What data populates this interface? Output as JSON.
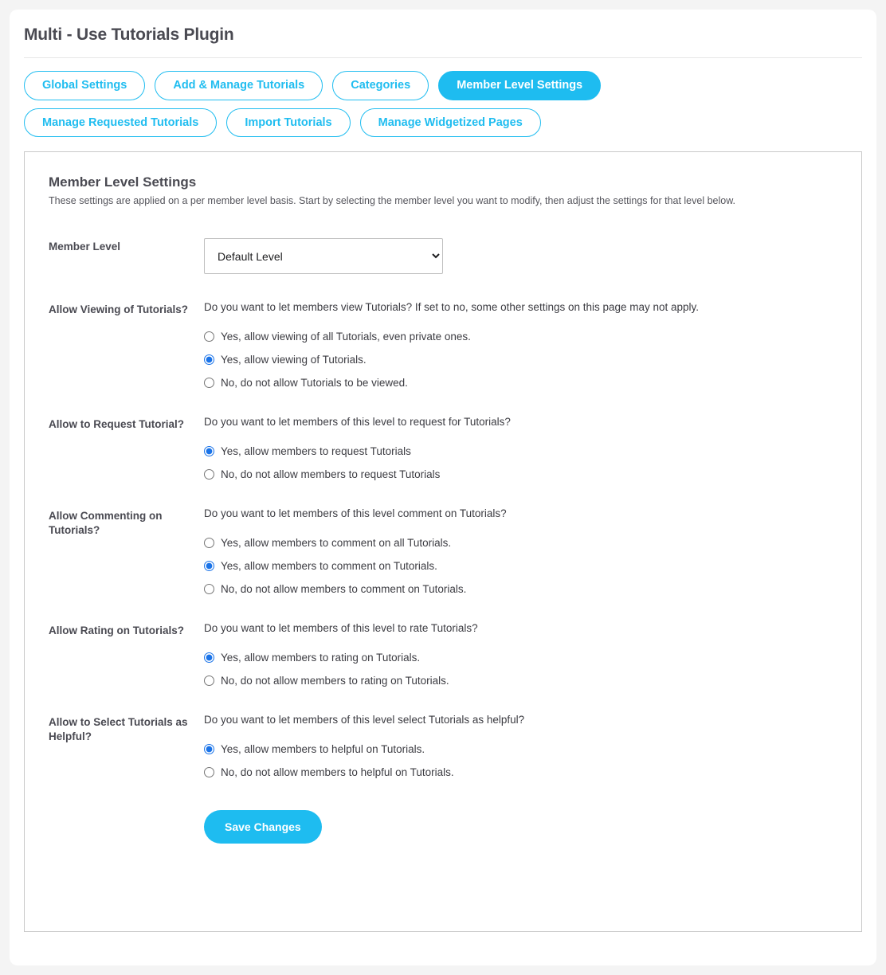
{
  "header": {
    "title": "Multi - Use Tutorials Plugin"
  },
  "tabs": [
    {
      "label": "Global Settings",
      "active": false
    },
    {
      "label": "Add & Manage Tutorials",
      "active": false
    },
    {
      "label": "Categories",
      "active": false
    },
    {
      "label": "Member Level Settings",
      "active": true
    },
    {
      "label": "Manage Requested Tutorials",
      "active": false
    },
    {
      "label": "Import Tutorials",
      "active": false
    },
    {
      "label": "Manage Widgetized Pages",
      "active": false
    }
  ],
  "panel": {
    "section_title": "Member Level Settings",
    "section_desc": "These settings are applied on a per member level basis. Start by selecting the member level you want to modify, then adjust the settings for that level below.",
    "member_level": {
      "label": "Member Level",
      "selected": "Default Level",
      "options": [
        "Default Level"
      ]
    },
    "groups": [
      {
        "label": "Allow Viewing of Tutorials?",
        "question": "Do you want to let members view Tutorials? If set to no, some other settings on this page may not apply.",
        "options": [
          {
            "text": "Yes, allow viewing of all Tutorials, even private ones.",
            "checked": false
          },
          {
            "text": "Yes, allow viewing of Tutorials.",
            "checked": true
          },
          {
            "text": "No, do not allow Tutorials to be viewed.",
            "checked": false
          }
        ]
      },
      {
        "label": "Allow to Request Tutorial?",
        "question": "Do you want to let members of this level to request for Tutorials?",
        "options": [
          {
            "text": "Yes, allow members to request Tutorials",
            "checked": true
          },
          {
            "text": "No, do not allow members to request Tutorials",
            "checked": false
          }
        ]
      },
      {
        "label": "Allow Commenting on Tutorials?",
        "question": "Do you want to let members of this level comment on Tutorials?",
        "options": [
          {
            "text": "Yes, allow members to comment on all Tutorials.",
            "checked": false
          },
          {
            "text": "Yes, allow members to comment on Tutorials.",
            "checked": true
          },
          {
            "text": "No, do not allow members to comment on Tutorials.",
            "checked": false
          }
        ]
      },
      {
        "label": "Allow Rating on Tutorials?",
        "question": "Do you want to let members of this level to rate Tutorials?",
        "options": [
          {
            "text": "Yes, allow members to rating on Tutorials.",
            "checked": true
          },
          {
            "text": "No, do not allow members to rating on Tutorials.",
            "checked": false
          }
        ]
      },
      {
        "label": "Allow to Select Tutorials as Helpful?",
        "question": "Do you want to let members of this level select Tutorials as helpful?",
        "options": [
          {
            "text": "Yes, allow members to helpful on Tutorials.",
            "checked": true
          },
          {
            "text": "No, do not allow members to helpful on Tutorials.",
            "checked": false
          }
        ]
      }
    ],
    "save_label": "Save Changes"
  },
  "colors": {
    "accent": "#1ebcf0",
    "radio_selected": "#1a73e8",
    "page_bg": "#f4f4f4",
    "text": "#4a4a52"
  }
}
